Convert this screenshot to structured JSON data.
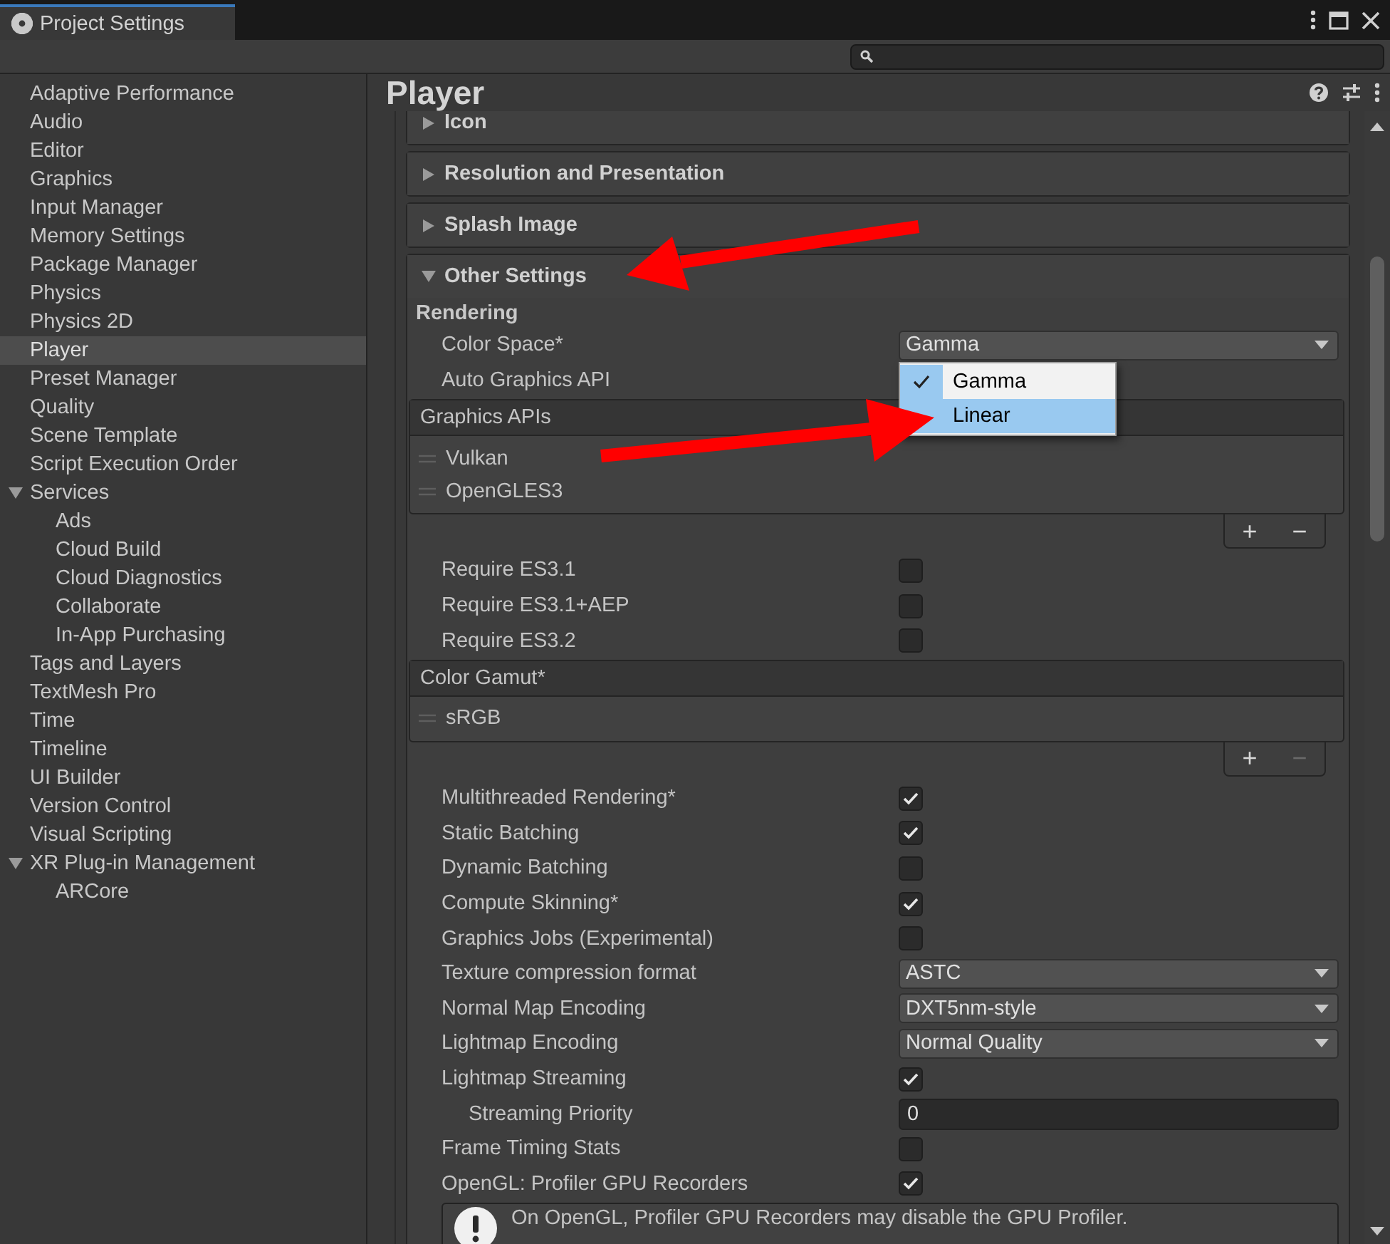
{
  "window": {
    "title": "Project Settings"
  },
  "sidebar": {
    "items": [
      {
        "label": "Adaptive Performance",
        "selected": false
      },
      {
        "label": "Audio",
        "selected": false
      },
      {
        "label": "Editor",
        "selected": false
      },
      {
        "label": "Graphics",
        "selected": false
      },
      {
        "label": "Input Manager",
        "selected": false
      },
      {
        "label": "Memory Settings",
        "selected": false
      },
      {
        "label": "Package Manager",
        "selected": false
      },
      {
        "label": "Physics",
        "selected": false
      },
      {
        "label": "Physics 2D",
        "selected": false
      },
      {
        "label": "Player",
        "selected": true
      },
      {
        "label": "Preset Manager",
        "selected": false
      },
      {
        "label": "Quality",
        "selected": false
      },
      {
        "label": "Scene Template",
        "selected": false
      },
      {
        "label": "Script Execution Order",
        "selected": false
      },
      {
        "label": "Services",
        "selected": false,
        "expanded": true,
        "children": [
          {
            "label": "Ads",
            "selected": false
          },
          {
            "label": "Cloud Build",
            "selected": false
          },
          {
            "label": "Cloud Diagnostics",
            "selected": false
          },
          {
            "label": "Collaborate",
            "selected": false
          },
          {
            "label": "In-App Purchasing",
            "selected": false
          }
        ]
      },
      {
        "label": "Tags and Layers",
        "selected": false
      },
      {
        "label": "TextMesh Pro",
        "selected": false
      },
      {
        "label": "Time",
        "selected": false
      },
      {
        "label": "Timeline",
        "selected": false
      },
      {
        "label": "UI Builder",
        "selected": false
      },
      {
        "label": "Version Control",
        "selected": false
      },
      {
        "label": "Visual Scripting",
        "selected": false
      },
      {
        "label": "XR Plug-in Management",
        "selected": false,
        "expanded": true,
        "children": [
          {
            "label": "ARCore",
            "selected": false
          }
        ]
      }
    ]
  },
  "inspector": {
    "title": "Player",
    "foldouts": [
      {
        "label": "Icon",
        "expanded": false
      },
      {
        "label": "Resolution and Presentation",
        "expanded": false
      },
      {
        "label": "Splash Image",
        "expanded": false
      },
      {
        "label": "Other Settings",
        "expanded": true
      }
    ],
    "other_settings": {
      "section": "Rendering",
      "rows": [
        {
          "kind": "dropdown",
          "label": "Color Space*",
          "value": "Gamma",
          "open": true,
          "options": [
            {
              "label": "Gamma",
              "selected": true,
              "hovered": false
            },
            {
              "label": "Linear",
              "selected": false,
              "hovered": true
            }
          ]
        },
        {
          "kind": "label",
          "label": "Auto Graphics API"
        },
        {
          "kind": "list",
          "title": "Graphics APIs",
          "items": [
            "Vulkan",
            "OpenGLES3"
          ],
          "add": "+",
          "remove": "−",
          "remove_disabled": false
        },
        {
          "kind": "checkbox",
          "label": "Require ES3.1",
          "checked": false
        },
        {
          "kind": "checkbox",
          "label": "Require ES3.1+AEP",
          "checked": false
        },
        {
          "kind": "checkbox",
          "label": "Require ES3.2",
          "checked": false
        },
        {
          "kind": "list",
          "title": "Color Gamut*",
          "items": [
            "sRGB"
          ],
          "add": "+",
          "remove": "−",
          "remove_disabled": true
        },
        {
          "kind": "checkbox",
          "label": "Multithreaded Rendering*",
          "checked": true
        },
        {
          "kind": "checkbox",
          "label": "Static Batching",
          "checked": true
        },
        {
          "kind": "checkbox",
          "label": "Dynamic Batching",
          "checked": false
        },
        {
          "kind": "checkbox",
          "label": "Compute Skinning*",
          "checked": true
        },
        {
          "kind": "checkbox",
          "label": "Graphics Jobs (Experimental)",
          "checked": false
        },
        {
          "kind": "dropdown",
          "label": "Texture compression format",
          "value": "ASTC",
          "open": false
        },
        {
          "kind": "dropdown",
          "label": "Normal Map Encoding",
          "value": "DXT5nm-style",
          "open": false
        },
        {
          "kind": "dropdown",
          "label": "Lightmap Encoding",
          "value": "Normal Quality",
          "open": false
        },
        {
          "kind": "checkbox",
          "label": "Lightmap Streaming",
          "checked": true,
          "children": [
            {
              "kind": "field",
              "label": "Streaming Priority",
              "value": "0"
            }
          ]
        },
        {
          "kind": "checkbox",
          "label": "Frame Timing Stats",
          "checked": false
        },
        {
          "kind": "checkbox",
          "label": "OpenGL: Profiler GPU Recorders",
          "checked": true
        },
        {
          "kind": "help",
          "text": "On OpenGL, Profiler GPU Recorders may disable the GPU Profiler."
        }
      ]
    }
  }
}
